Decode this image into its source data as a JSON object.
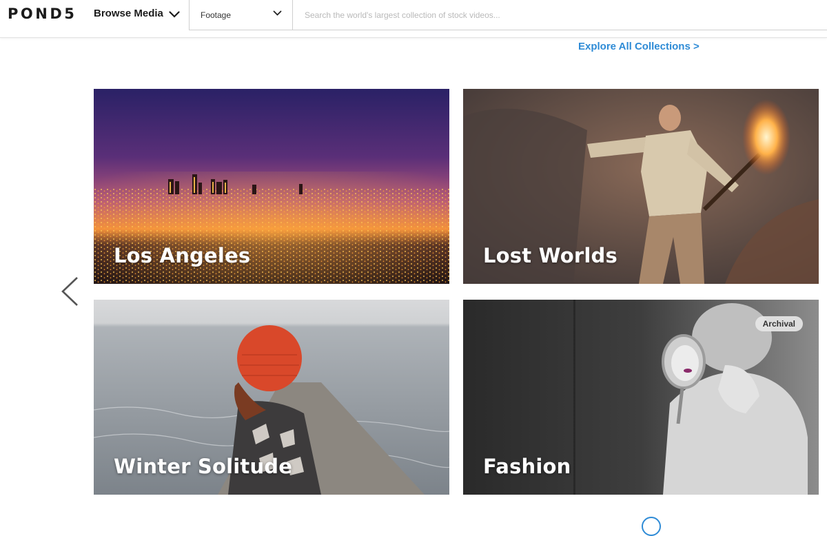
{
  "header": {
    "logo": "POND5",
    "browse_label": "Browse Media",
    "media_type": "Footage",
    "search_placeholder": "Search the world's largest collection of stock videos..."
  },
  "explore_link": "Explore All Collections >",
  "cards": [
    {
      "title": "Los Angeles"
    },
    {
      "title": "Lost Worlds"
    },
    {
      "title": "Winter Solitude"
    },
    {
      "title": "Fashion",
      "badge": "Archival"
    }
  ],
  "colors": {
    "accent": "#2e8bd6",
    "text_dark": "#1b1b1b"
  },
  "icons": {
    "browse_chevron": "chevron-down-icon",
    "type_chevron": "chevron-down-icon",
    "carousel_prev": "chevron-left-icon"
  }
}
